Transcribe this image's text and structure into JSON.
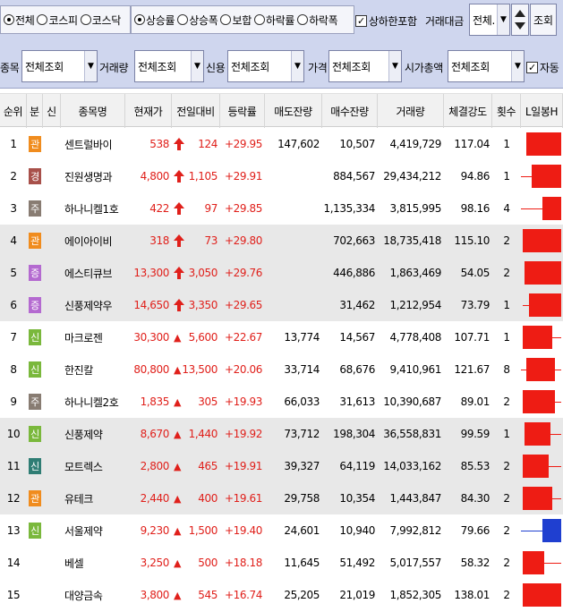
{
  "toolbar": {
    "market_options": [
      {
        "label": "전체",
        "checked": true
      },
      {
        "label": "코스피",
        "checked": false
      },
      {
        "label": "코스닥",
        "checked": false
      }
    ],
    "sort_options": [
      {
        "label": "상승률",
        "checked": true
      },
      {
        "label": "상승폭",
        "checked": false
      },
      {
        "label": "보합",
        "checked": false
      },
      {
        "label": "하락률",
        "checked": false
      },
      {
        "label": "하락폭",
        "checked": false
      }
    ],
    "include_limit": {
      "label": "상하한포함",
      "checked": true
    },
    "trading_value_label": "거래대금",
    "trading_value": "전체.",
    "query_label": "조회",
    "item_label": "종목",
    "item_value": "전체조회",
    "volume_label": "거래량",
    "volume_value": "전체조회",
    "credit_label": "신용",
    "credit_value": "전체조회",
    "price_label": "가격",
    "price_value": "전체조회",
    "market_cap_label": "시가총액",
    "market_cap_value": "전체조회",
    "auto": {
      "label": "자동",
      "checked": true
    }
  },
  "grid": {
    "columns": [
      "순위",
      "분",
      "신",
      "종목명",
      "현재가",
      "전일대비",
      "등락률",
      "매도잔량",
      "매수잔량",
      "거래량",
      "체결강도",
      "횟수",
      "L일봉H"
    ],
    "rows": [
      {
        "rank": "1",
        "badge": "관",
        "badge_color": "#f08c1e",
        "name": "센트럴바이",
        "price": "538",
        "arrow": "up-limit",
        "change": "124",
        "rate": "+29.95",
        "ask": "147,602",
        "bid": "10,507",
        "volume": "4,419,729",
        "strength": "117.04",
        "count": "1",
        "candle": {
          "color": "red",
          "open": 0.12,
          "close": 0.95,
          "low": 0.12,
          "high": 0.95
        }
      },
      {
        "rank": "2",
        "badge": "경",
        "badge_color": "#a8504a",
        "name": "진원생명과",
        "price": "4,800",
        "arrow": "up-limit",
        "change": "1,105",
        "rate": "+29.91",
        "ask": "",
        "bid": "884,567",
        "volume": "29,434,212",
        "strength": "94.86",
        "count": "1",
        "candle": {
          "color": "red",
          "open": 0.25,
          "close": 0.95,
          "low": 0.0,
          "high": 0.95
        }
      },
      {
        "rank": "3",
        "badge": "주",
        "badge_color": "#887c72",
        "name": "하나니켈1호",
        "price": "422",
        "arrow": "up-limit",
        "change": "97",
        "rate": "+29.85",
        "ask": "",
        "bid": "1,135,334",
        "volume": "3,815,995",
        "strength": "98.16",
        "count": "4",
        "candle": {
          "color": "red",
          "open": 0.5,
          "close": 0.95,
          "low": 0.0,
          "high": 0.95
        }
      },
      {
        "rank": "4",
        "badge": "관",
        "badge_color": "#f08c1e",
        "name": "에이아이비",
        "price": "318",
        "arrow": "up-limit",
        "change": "73",
        "rate": "+29.80",
        "ask": "",
        "bid": "702,663",
        "volume": "18,735,418",
        "strength": "115.10",
        "count": "2",
        "candle": {
          "color": "red",
          "open": 0.05,
          "close": 0.95,
          "low": 0.05,
          "high": 0.95
        }
      },
      {
        "rank": "5",
        "badge": "증",
        "badge_color": "#b46ad0",
        "name": "에스티큐브",
        "price": "13,300",
        "arrow": "up-limit",
        "change": "3,050",
        "rate": "+29.76",
        "ask": "",
        "bid": "446,886",
        "volume": "1,863,469",
        "strength": "54.05",
        "count": "2",
        "candle": {
          "color": "red",
          "open": 0.08,
          "close": 0.95,
          "low": 0.08,
          "high": 0.95
        }
      },
      {
        "rank": "6",
        "badge": "증",
        "badge_color": "#b46ad0",
        "name": "신풍제약우",
        "price": "14,650",
        "arrow": "up-limit",
        "change": "3,350",
        "rate": "+29.65",
        "ask": "",
        "bid": "31,462",
        "volume": "1,212,954",
        "strength": "73.79",
        "count": "1",
        "candle": {
          "color": "red",
          "open": 0.2,
          "close": 0.95,
          "low": 0.05,
          "high": 0.95
        }
      },
      {
        "rank": "7",
        "badge": "신",
        "badge_color": "#7ab83c",
        "name": "마크로젠",
        "price": "30,300",
        "arrow": "up",
        "change": "5,600",
        "rate": "+22.67",
        "ask": "13,774",
        "bid": "14,567",
        "volume": "4,778,408",
        "strength": "107.71",
        "count": "1",
        "candle": {
          "color": "red",
          "open": 0.05,
          "close": 0.75,
          "low": 0.05,
          "high": 0.95
        }
      },
      {
        "rank": "8",
        "badge": "신",
        "badge_color": "#7ab83c",
        "name": "한진칼",
        "price": "80,800",
        "arrow": "up",
        "change": "13,500",
        "rate": "+20.06",
        "ask": "33,714",
        "bid": "68,676",
        "volume": "9,410,961",
        "strength": "121.67",
        "count": "8",
        "candle": {
          "color": "red",
          "open": 0.12,
          "close": 0.8,
          "low": 0.0,
          "high": 0.95
        }
      },
      {
        "rank": "9",
        "badge": "주",
        "badge_color": "#887c72",
        "name": "하나니켈2호",
        "price": "1,835",
        "arrow": "up",
        "change": "305",
        "rate": "+19.93",
        "ask": "66,033",
        "bid": "31,613",
        "volume": "10,390,687",
        "strength": "89.01",
        "count": "2",
        "candle": {
          "color": "red",
          "open": 0.05,
          "close": 0.8,
          "low": 0.05,
          "high": 0.95
        }
      },
      {
        "rank": "10",
        "badge": "신",
        "badge_color": "#7ab83c",
        "name": "신풍제약",
        "price": "8,670",
        "arrow": "up",
        "change": "1,440",
        "rate": "+19.92",
        "ask": "73,712",
        "bid": "198,304",
        "volume": "36,558,831",
        "strength": "99.59",
        "count": "1",
        "candle": {
          "color": "red",
          "open": 0.08,
          "close": 0.7,
          "low": 0.08,
          "high": 0.95
        }
      },
      {
        "rank": "11",
        "badge": "신",
        "badge_color": "#2f7d74",
        "name": "모트렉스",
        "price": "2,800",
        "arrow": "up",
        "change": "465",
        "rate": "+19.91",
        "ask": "39,327",
        "bid": "64,119",
        "volume": "14,033,162",
        "strength": "85.53",
        "count": "2",
        "candle": {
          "color": "red",
          "open": 0.05,
          "close": 0.65,
          "low": 0.05,
          "high": 0.95
        }
      },
      {
        "rank": "12",
        "badge": "관",
        "badge_color": "#f08c1e",
        "name": "유테크",
        "price": "2,440",
        "arrow": "up",
        "change": "400",
        "rate": "+19.61",
        "ask": "29,758",
        "bid": "10,354",
        "volume": "1,443,847",
        "strength": "84.30",
        "count": "2",
        "candle": {
          "color": "red",
          "open": 0.05,
          "close": 0.75,
          "low": 0.05,
          "high": 0.95
        }
      },
      {
        "rank": "13",
        "badge": "신",
        "badge_color": "#7ab83c",
        "name": "서울제약",
        "price": "9,230",
        "arrow": "up",
        "change": "1,500",
        "rate": "+19.40",
        "ask": "24,601",
        "bid": "10,940",
        "volume": "7,992,812",
        "strength": "79.66",
        "count": "2",
        "candle": {
          "color": "blue",
          "open": 0.95,
          "close": 0.5,
          "low": 0.0,
          "high": 0.95
        }
      },
      {
        "rank": "14",
        "badge": "",
        "badge_color": "",
        "name": "베셀",
        "price": "3,250",
        "arrow": "up",
        "change": "500",
        "rate": "+18.18",
        "ask": "11,645",
        "bid": "51,492",
        "volume": "5,017,557",
        "strength": "58.32",
        "count": "2",
        "candle": {
          "color": "red",
          "open": 0.05,
          "close": 0.55,
          "low": 0.05,
          "high": 0.95
        }
      },
      {
        "rank": "15",
        "badge": "",
        "badge_color": "",
        "name": "대양금속",
        "price": "3,800",
        "arrow": "up",
        "change": "545",
        "rate": "+16.74",
        "ask": "25,205",
        "bid": "21,019",
        "volume": "1,852,305",
        "strength": "138.01",
        "count": "2",
        "candle": {
          "color": "red",
          "open": 0.05,
          "close": 0.95,
          "low": 0.05,
          "high": 0.95
        }
      }
    ]
  }
}
